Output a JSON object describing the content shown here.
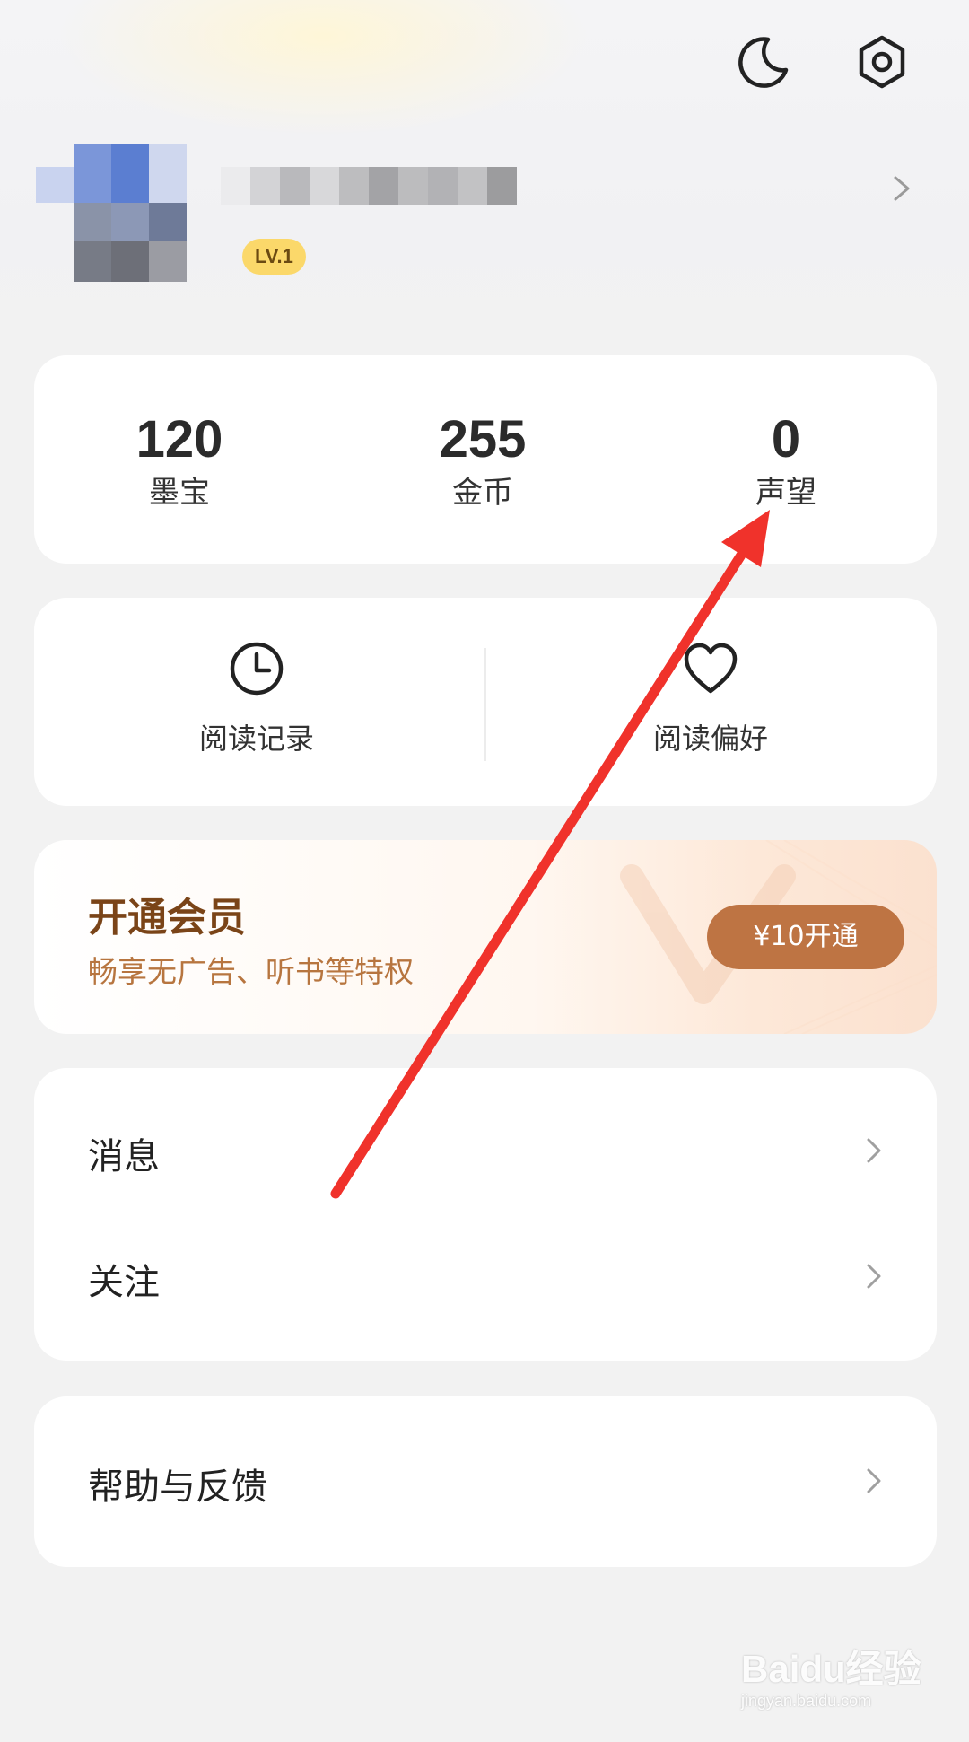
{
  "profile": {
    "level": "LV.1"
  },
  "stats": [
    {
      "value": "120",
      "label": "墨宝"
    },
    {
      "value": "255",
      "label": "金币"
    },
    {
      "value": "0",
      "label": "声望"
    }
  ],
  "quick_actions": [
    {
      "label": "阅读记录",
      "icon": "clock-icon"
    },
    {
      "label": "阅读偏好",
      "icon": "heart-icon"
    }
  ],
  "vip": {
    "title": "开通会员",
    "subtitle": "畅享无广告、听书等特权",
    "button": "¥10开通"
  },
  "menu": [
    {
      "label": "消息"
    },
    {
      "label": "关注"
    }
  ],
  "menu2": [
    {
      "label": "帮助与反馈"
    }
  ],
  "watermark": {
    "brand": "Baidu经验",
    "url": "jingyan.baidu.com"
  },
  "colors": {
    "level_badge": "#fbd86a",
    "vip_title": "#7a4418",
    "vip_subtitle": "#b7753f",
    "vip_button": "#be7443",
    "annotation_arrow": "#f0322b"
  }
}
